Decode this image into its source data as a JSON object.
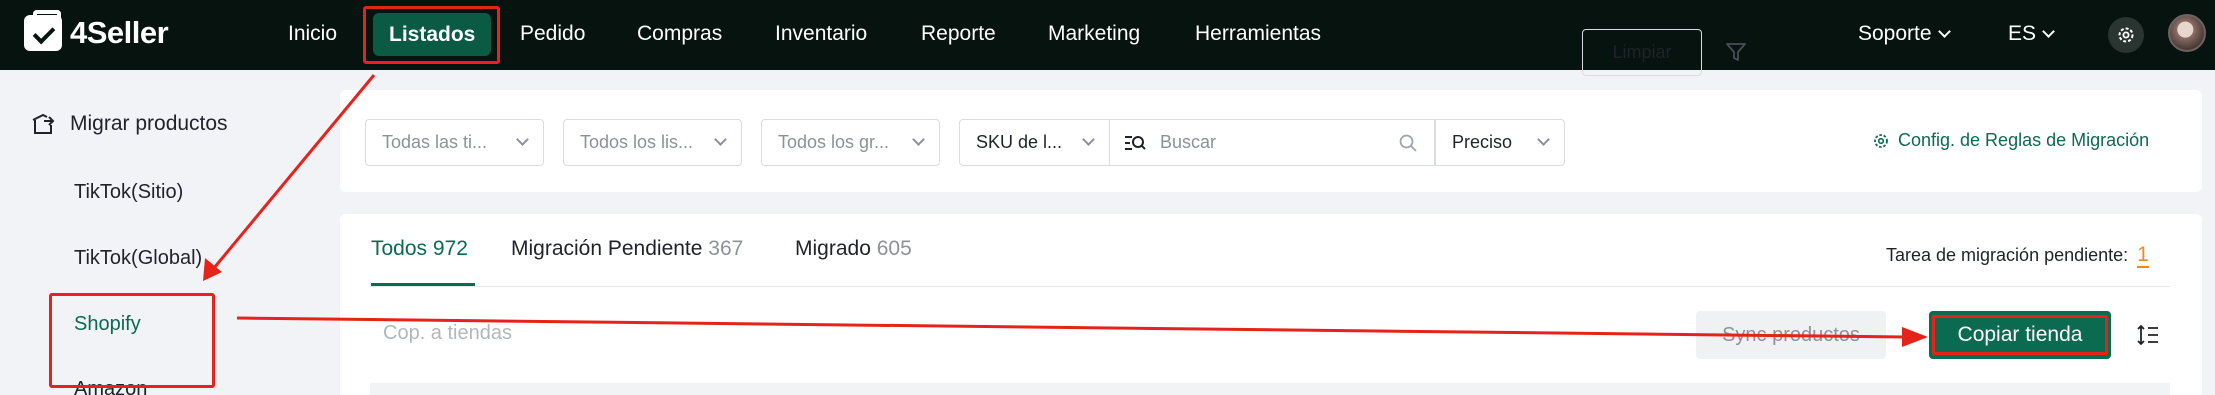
{
  "brand": {
    "name": "4Seller"
  },
  "nav": {
    "items": [
      {
        "label": "Inicio"
      },
      {
        "label": "Listados"
      },
      {
        "label": "Pedido"
      },
      {
        "label": "Compras"
      },
      {
        "label": "Inventario"
      },
      {
        "label": "Reporte"
      },
      {
        "label": "Marketing"
      },
      {
        "label": "Herramientas"
      }
    ],
    "support_label": "Soporte",
    "language_label": "ES"
  },
  "sidebar": {
    "title": "Migrar productos",
    "items": [
      {
        "label": "TikTok(Sitio)"
      },
      {
        "label": "TikTok(Global)"
      },
      {
        "label": "Shopify"
      },
      {
        "label": "Amazon"
      }
    ]
  },
  "filters": {
    "store_type": "Todas las ti...",
    "listing": "Todos los lis...",
    "group": "Todos los gr...",
    "sku_mode": "SKU de l...",
    "search_placeholder": "Buscar",
    "match_mode": "Preciso",
    "clear_label": "Limpiar",
    "config_link": "Config. de Reglas de Migración"
  },
  "tabs": [
    {
      "label": "Todos",
      "count": "972"
    },
    {
      "label": "Migración Pendiente",
      "count": "367"
    },
    {
      "label": "Migrado",
      "count": "605"
    }
  ],
  "pending_task": {
    "label": "Tarea de migración pendiente:",
    "count": "1"
  },
  "toolbar": {
    "copy_input_placeholder": "Cop. a tiendas",
    "sync_label": "Sync productos",
    "copy_store_label": "Copiar tienda"
  },
  "colors": {
    "brand_green": "#0b6b50",
    "annotation_red": "#e5231b",
    "topbar": "#07130f"
  }
}
